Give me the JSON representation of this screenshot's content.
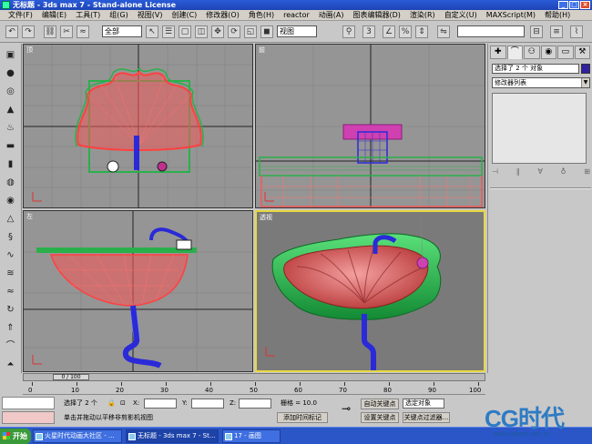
{
  "window": {
    "title": "无标题 - 3ds max 7 - Stand-alone License"
  },
  "menu": [
    "文件(F)",
    "编辑(E)",
    "工具(T)",
    "组(G)",
    "视图(V)",
    "创建(C)",
    "修改器(O)",
    "角色(H)",
    "reactor",
    "动画(A)",
    "图表编辑器(D)",
    "渲染(R)",
    "自定义(U)",
    "MAXScript(M)",
    "帮助(H)"
  ],
  "toolbar": {
    "filter_value": "全部",
    "refcoord_value": "视图"
  },
  "viewports": {
    "top": "顶",
    "front": "前",
    "left": "左",
    "perspective": "透视"
  },
  "command_panel": {
    "object_name": "选择了 2 个 对象",
    "modifier_list": "修改器列表"
  },
  "timeline": {
    "slider": "0 / 100",
    "ticks": [
      "0",
      "10",
      "20",
      "30",
      "40",
      "50",
      "60",
      "70",
      "80",
      "90",
      "100"
    ]
  },
  "status": {
    "selection": "选择了 2 个",
    "x_label": "X:",
    "y_label": "Y:",
    "z_label": "Z:",
    "grid": "栅格 = 10.0",
    "prompt": "单击并拖动以平移非剪影机视图",
    "add_time_tag": "添加时间标记",
    "auto_key": "自动关键点",
    "set_key": "设置关键点",
    "selected_obj": "选定对象",
    "key_filters": "关键点过滤器..."
  },
  "taskbar": {
    "start": "开始",
    "items": [
      "火星时代动画大社区 - ...",
      "无标题 - 3ds max 7 - St...",
      "17 - 画图"
    ]
  },
  "watermark": {
    "logo": "CG时代",
    "url": "www.cgtime.com.cn"
  },
  "colors": {
    "title_bar": "#2a5bd8",
    "viewport_bg": "#959595",
    "active_border": "#e8d840",
    "wire_red": "#e23c3c",
    "wire_green": "#2ab04a",
    "wire_blue": "#2a2ad8"
  }
}
